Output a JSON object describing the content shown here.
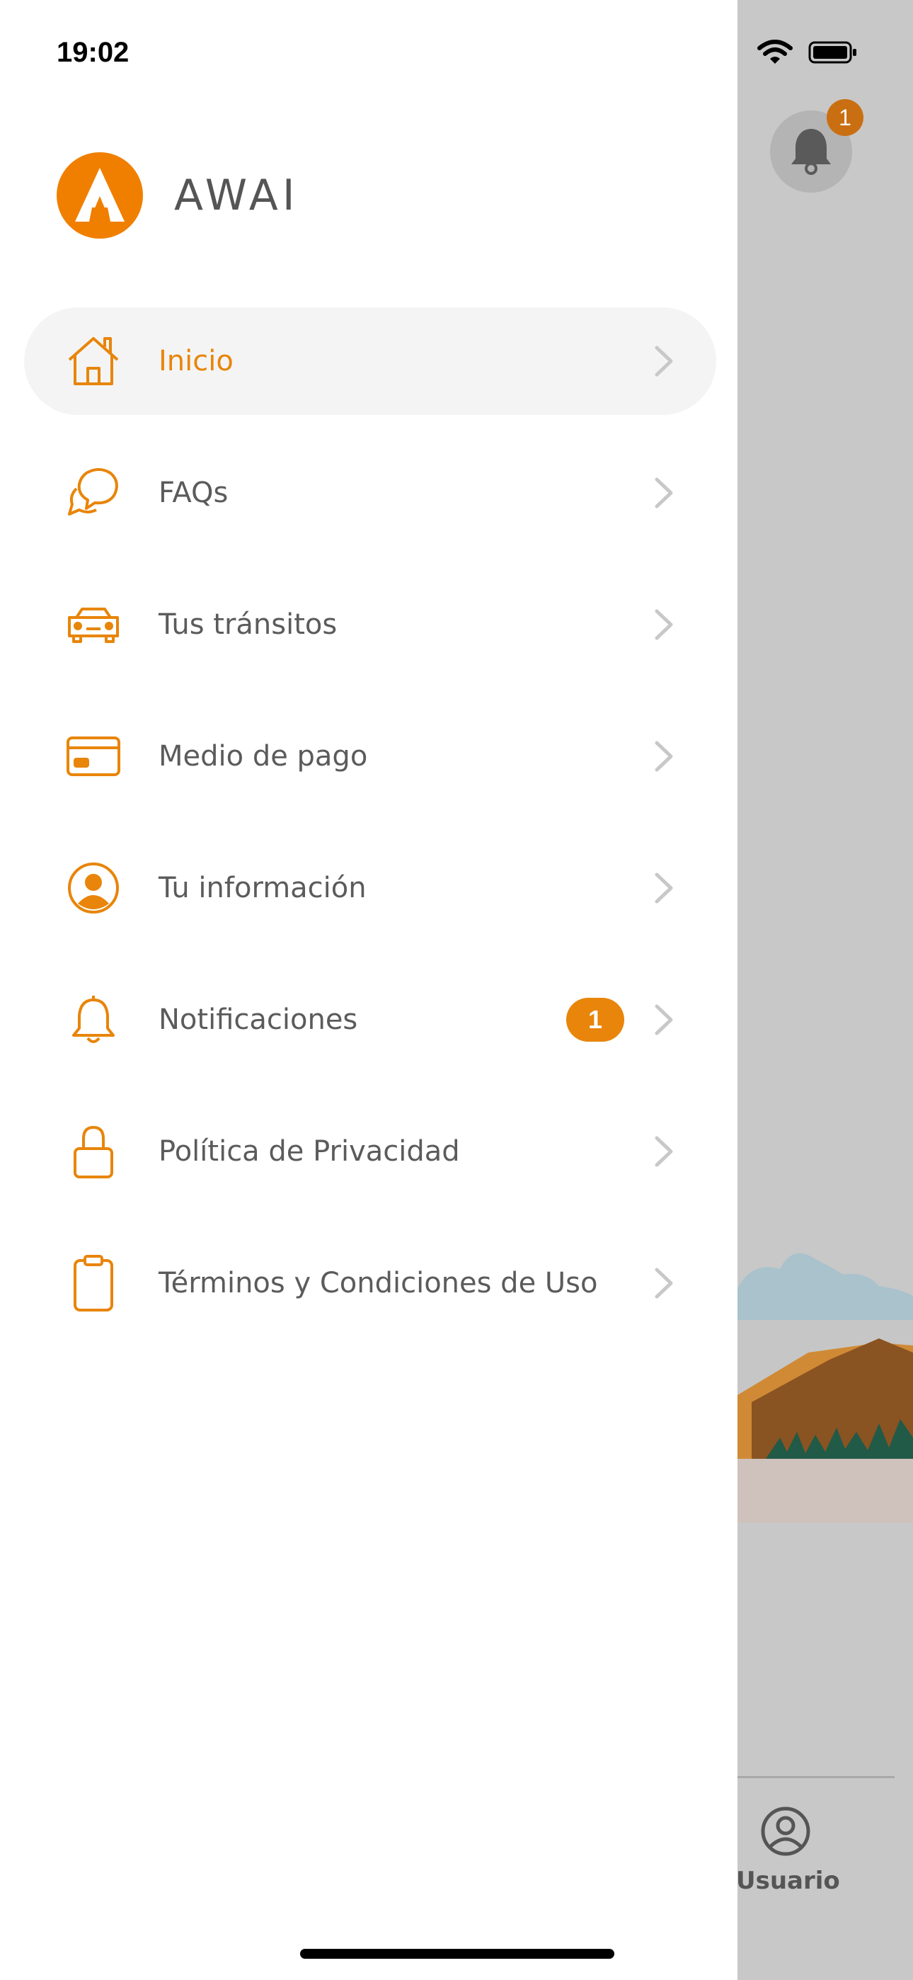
{
  "status_bar": {
    "time": "19:02"
  },
  "brand": {
    "name": "AWAI"
  },
  "colors": {
    "accent": "#e8850a",
    "text": "#5b5b5b",
    "active_bg": "#f4f4f4",
    "chevron": "#c8c8c8"
  },
  "menu": [
    {
      "label": "Inicio",
      "icon": "home-icon",
      "active": true
    },
    {
      "label": "FAQs",
      "icon": "chat-bubbles-icon"
    },
    {
      "label": "Tus tránsitos",
      "icon": "car-icon"
    },
    {
      "label": "Medio de pago",
      "icon": "credit-card-icon"
    },
    {
      "label": "Tu información",
      "icon": "user-circle-icon"
    },
    {
      "label": "Notificaciones",
      "icon": "bell-icon",
      "badge": "1"
    },
    {
      "label": "Política de Privacidad",
      "icon": "lock-icon"
    },
    {
      "label": "Términos y Condiciones de Uso",
      "icon": "clipboard-icon"
    }
  ],
  "background": {
    "notification_count": "1",
    "tab_user_label": "Usuario"
  }
}
